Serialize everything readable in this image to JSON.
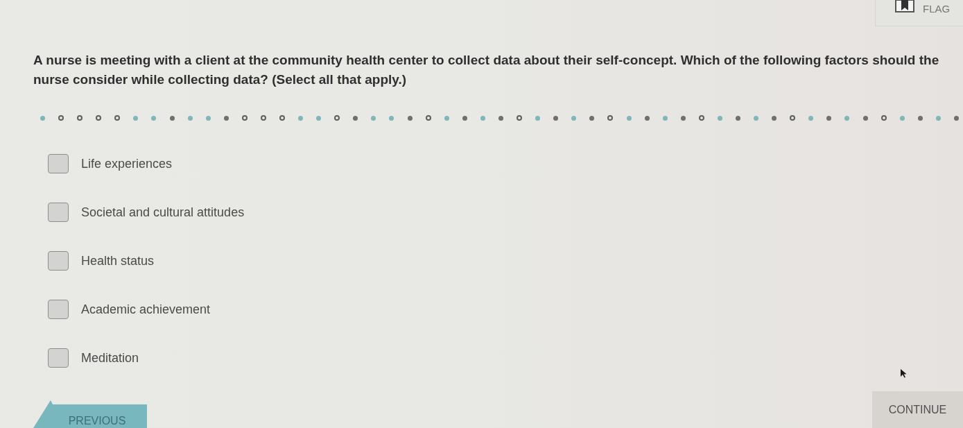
{
  "flag_button": {
    "label": "FLAG"
  },
  "question": {
    "text": "A nurse is meeting with a client at the community health center to collect data about their self-concept. Which of the following factors should the nurse consider while collecting data? (Select all that apply.)"
  },
  "progress_dots": [
    {
      "kind": "dot",
      "color": "#7fb6b8"
    },
    {
      "kind": "ring",
      "color": "#5e5e5e"
    },
    {
      "kind": "ring",
      "color": "#5e5e5e"
    },
    {
      "kind": "ring",
      "color": "#5e5e5e"
    },
    {
      "kind": "ring",
      "color": "#5e5e5e"
    },
    {
      "kind": "dot",
      "color": "#7fb6b8"
    },
    {
      "kind": "dot",
      "color": "#7fb6b8"
    },
    {
      "kind": "dot",
      "color": "#6f6f6f"
    },
    {
      "kind": "dot",
      "color": "#7fb6b8"
    },
    {
      "kind": "dot",
      "color": "#7fb6b8"
    },
    {
      "kind": "dot",
      "color": "#6f6f6f"
    },
    {
      "kind": "ring",
      "color": "#5e5e5e"
    },
    {
      "kind": "ring",
      "color": "#5e5e5e"
    },
    {
      "kind": "ring",
      "color": "#5e5e5e"
    },
    {
      "kind": "dot",
      "color": "#7fb6b8"
    },
    {
      "kind": "dot",
      "color": "#7fb6b8"
    },
    {
      "kind": "ring",
      "color": "#5e5e5e"
    },
    {
      "kind": "dot",
      "color": "#6f6f6f"
    },
    {
      "kind": "dot",
      "color": "#7fb6b8"
    },
    {
      "kind": "dot",
      "color": "#7fb6b8"
    },
    {
      "kind": "dot",
      "color": "#6f6f6f"
    },
    {
      "kind": "ring",
      "color": "#5e5e5e"
    },
    {
      "kind": "dot",
      "color": "#7fb6b8"
    },
    {
      "kind": "dot",
      "color": "#6f6f6f"
    },
    {
      "kind": "dot",
      "color": "#7fb6b8"
    },
    {
      "kind": "dot",
      "color": "#6f6f6f"
    },
    {
      "kind": "ring",
      "color": "#5e5e5e"
    },
    {
      "kind": "dot",
      "color": "#7fb6b8"
    },
    {
      "kind": "dot",
      "color": "#6f6f6f"
    },
    {
      "kind": "dot",
      "color": "#7fb6b8"
    },
    {
      "kind": "dot",
      "color": "#6f6f6f"
    },
    {
      "kind": "ring",
      "color": "#5e5e5e"
    },
    {
      "kind": "dot",
      "color": "#7fb6b8"
    },
    {
      "kind": "dot",
      "color": "#6f6f6f"
    },
    {
      "kind": "dot",
      "color": "#7fb6b8"
    },
    {
      "kind": "dot",
      "color": "#6f6f6f"
    },
    {
      "kind": "ring",
      "color": "#5e5e5e"
    },
    {
      "kind": "dot",
      "color": "#7fb6b8"
    },
    {
      "kind": "dot",
      "color": "#6f6f6f"
    },
    {
      "kind": "dot",
      "color": "#7fb6b8"
    },
    {
      "kind": "dot",
      "color": "#6f6f6f"
    },
    {
      "kind": "ring",
      "color": "#5e5e5e"
    },
    {
      "kind": "dot",
      "color": "#7fb6b8"
    },
    {
      "kind": "dot",
      "color": "#6f6f6f"
    },
    {
      "kind": "dot",
      "color": "#7fb6b8"
    },
    {
      "kind": "dot",
      "color": "#6f6f6f"
    },
    {
      "kind": "ring",
      "color": "#5e5e5e"
    },
    {
      "kind": "dot",
      "color": "#7fb6b8"
    },
    {
      "kind": "dot",
      "color": "#6f6f6f"
    },
    {
      "kind": "dot",
      "color": "#7fb6b8"
    },
    {
      "kind": "dot",
      "color": "#6f6f6f"
    }
  ],
  "options": [
    {
      "label": "Life experiences",
      "checked": false
    },
    {
      "label": "Societal and cultural attitudes",
      "checked": false
    },
    {
      "label": "Health status",
      "checked": false
    },
    {
      "label": "Academic achievement",
      "checked": false
    },
    {
      "label": "Meditation",
      "checked": false
    }
  ],
  "buttons": [
    {
      "kind": "previous",
      "label": "PREVIOUS"
    },
    {
      "kind": "continue",
      "label": "CONTINUE"
    }
  ]
}
